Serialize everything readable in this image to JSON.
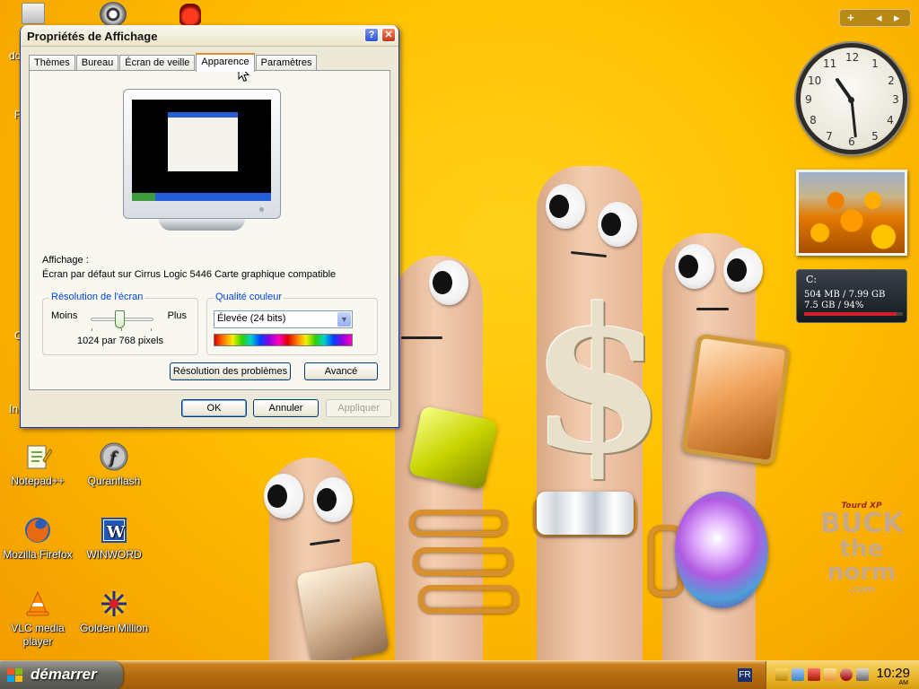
{
  "desktop": {
    "icons": [
      {
        "label": "Notepad++"
      },
      {
        "label": "Quranflash"
      },
      {
        "label": "Mozilla Firefox"
      },
      {
        "label": "WINWORD"
      },
      {
        "label": "VLC media player"
      },
      {
        "label": "Golden Million"
      }
    ],
    "edge_labels": [
      "do",
      "F",
      "C",
      "In"
    ]
  },
  "dialog": {
    "title": "Propriétés de Affichage",
    "help_button": "?",
    "close_button": "✕",
    "tabs": [
      {
        "label": "Thèmes"
      },
      {
        "label": "Bureau"
      },
      {
        "label": "Écran de veille"
      },
      {
        "label": "Apparence"
      },
      {
        "label": "Paramètres"
      }
    ],
    "active_tab": "Apparence",
    "affichage_label": "Affichage :",
    "affichage_value": "Écran par défaut sur Cirrus Logic 5446 Carte graphique compatible",
    "resolution": {
      "legend": "Résolution de l'écran",
      "min_label": "Moins",
      "max_label": "Plus",
      "value": "1024 par 768 pixels"
    },
    "color_quality": {
      "legend": "Qualité couleur",
      "selected": "Élevée (24 bits)"
    },
    "troubleshoot_button": "Résolution des problèmes",
    "advanced_button": "Avancé",
    "ok_button": "OK",
    "cancel_button": "Annuler",
    "apply_button": "Appliquer"
  },
  "sidebar": {
    "add_label": "+",
    "prev_label": "◂",
    "next_label": "▸",
    "clock_numbers": [
      "12",
      "1",
      "2",
      "3",
      "4",
      "5",
      "6",
      "7",
      "8",
      "9",
      "10",
      "11"
    ],
    "drive": {
      "name": "C:",
      "line1": "504 MB / 7.99 GB",
      "line2": "7.5 GB / 94%",
      "usage_percent": 94
    }
  },
  "watermark": {
    "line1": "Tourd XP",
    "line2": "BUCK",
    "line3": "the norm",
    "line4": ".com"
  },
  "taskbar": {
    "start_label": "démarrer",
    "language": "FR",
    "time": "10:29",
    "ampm": "AM"
  },
  "colors": {
    "xp_blue": "#0831d9",
    "tab_highlight": "#e68b2c",
    "legend_blue": "#0046d5",
    "desktop_yellow": "#ffbf00",
    "drive_meter": "#d0202a"
  }
}
